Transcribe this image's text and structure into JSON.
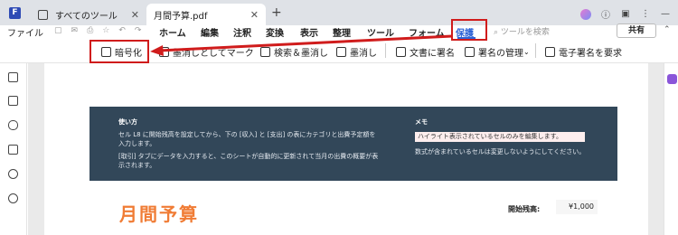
{
  "tabs": [
    {
      "label": "すべてのツール"
    },
    {
      "label": "月間予算.pdf"
    }
  ],
  "menu": {
    "file": "ファイル",
    "items": [
      "ホーム",
      "編集",
      "注釈",
      "変換",
      "表示",
      "整理",
      "ツール",
      "フォーム",
      "保護"
    ],
    "search_placeholder": "ツールを検索",
    "share": "共有"
  },
  "ribbon": {
    "encrypt": "暗号化",
    "redact_partial": "墨消しとしてマーク",
    "search_redact": "検索＆墨消し",
    "redact": "墨消し",
    "sign_doc": "文書に署名",
    "manage_sign": "署名の管理",
    "request_esign": "電子署名を要求"
  },
  "document": {
    "instructions_title": "使い方",
    "instructions_1": "セル L8 に開始残高を設定してから、下の [収入] と [支出] の表にカテゴリと出費予定額を入力します。",
    "instructions_2": "[取引] タブにデータを入力すると、このシートが自動的に更新されて当月の出費の概要が表示されます。",
    "memo_title": "メモ",
    "memo_1": "ハイライト表示されているセルのみを編集します。",
    "memo_2": "数式が含まれているセルは変更しないようにしてください。",
    "title": "月間予算",
    "starting_balance_label": "開始残高:",
    "starting_balance_value": "¥1,000"
  },
  "colors": {
    "accent_red": "#d01c1c",
    "title_orange": "#f07c35",
    "panel_navy": "#324759"
  }
}
